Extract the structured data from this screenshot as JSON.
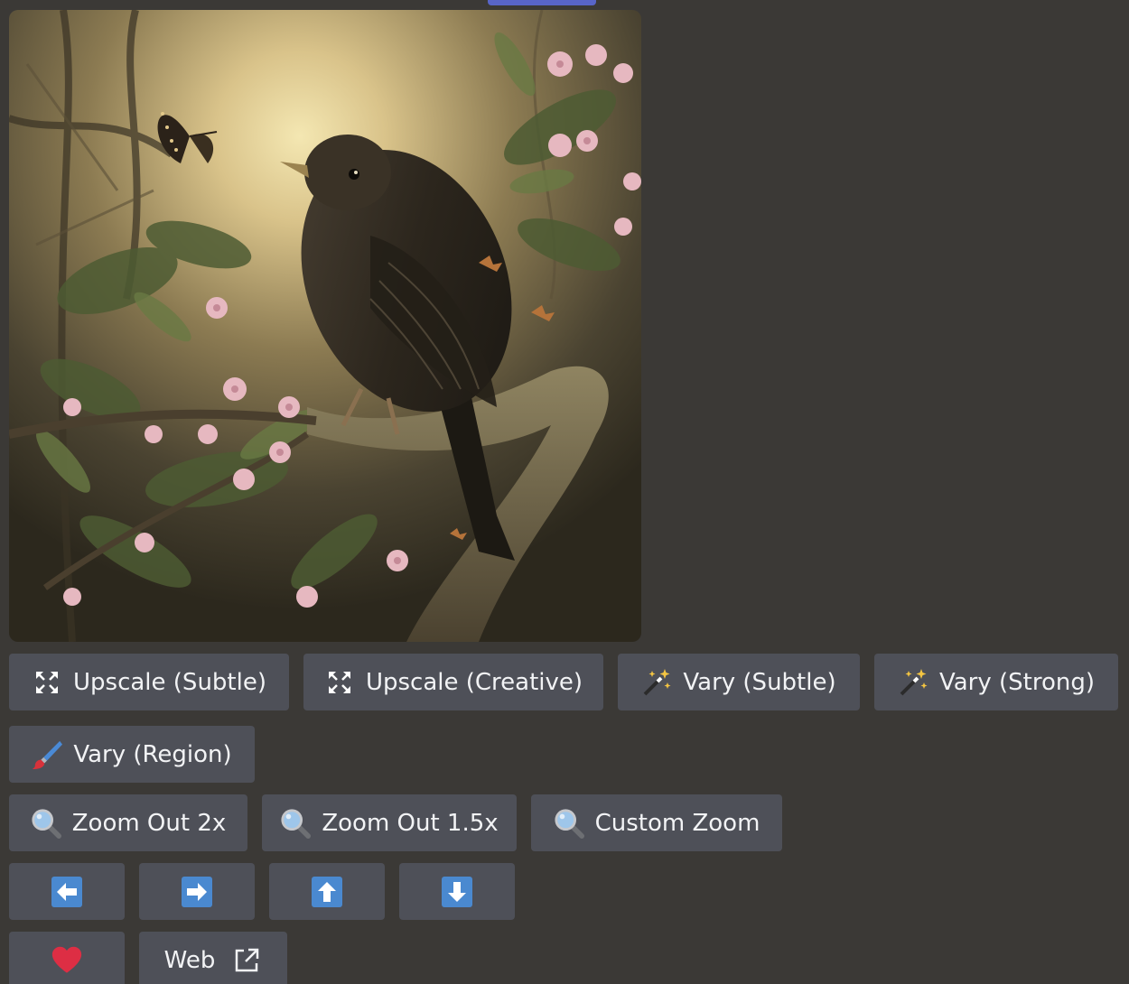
{
  "image": {
    "alt_subject": "bird-on-blossom-branch"
  },
  "buttons": {
    "row1": [
      {
        "label": "Upscale (Subtle)",
        "icon": "expand-arrows-icon"
      },
      {
        "label": "Upscale (Creative)",
        "icon": "expand-arrows-icon"
      },
      {
        "label": "Vary (Subtle)",
        "icon": "magic-wand-icon"
      },
      {
        "label": "Vary (Strong)",
        "icon": "magic-wand-icon"
      }
    ],
    "row2": [
      {
        "label": "Vary (Region)",
        "icon": "paintbrush-icon"
      }
    ],
    "row3": [
      {
        "label": "Zoom Out 2x",
        "icon": "magnifier-icon"
      },
      {
        "label": "Zoom Out 1.5x",
        "icon": "magnifier-icon"
      },
      {
        "label": "Custom Zoom",
        "icon": "magnifier-icon"
      }
    ],
    "row4": [
      {
        "icon": "arrow-left-icon"
      },
      {
        "icon": "arrow-right-icon"
      },
      {
        "icon": "arrow-up-icon"
      },
      {
        "icon": "arrow-down-icon"
      }
    ],
    "row5": [
      {
        "icon": "heart-icon"
      },
      {
        "label": "Web",
        "icon": "external-link-icon"
      }
    ]
  },
  "colors": {
    "background": "#3b3936",
    "button": "#4e5058",
    "arrow_tile": "#4a89d0",
    "heart": "#dd2e44"
  }
}
